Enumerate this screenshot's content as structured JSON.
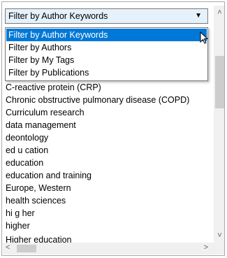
{
  "filter_select": {
    "selected": "Filter by Author Keywords",
    "arrow": "▼"
  },
  "dropdown_options": [
    "Filter by Author Keywords",
    "Filter by Authors",
    "Filter by My Tags",
    "Filter by Publications"
  ],
  "selected_option_index": 0,
  "keywords": [
    "C-reactive protein (CRP)",
    "Chronic obstructive pulmonary disease (COPD)",
    "Curriculum research",
    "data management",
    "deontology",
    "ed u cation",
    "education",
    "education and training",
    "Europe, Western",
    "health sciences",
    "hi g her",
    "higher",
    "Higher education"
  ],
  "scrollbar": {
    "up": "˄",
    "down": "˅",
    "left": "<",
    "right": ">"
  },
  "colors": {
    "selection": "#0078d7",
    "select_bg": "#e5f1fb",
    "border": "#7a7a7a"
  }
}
